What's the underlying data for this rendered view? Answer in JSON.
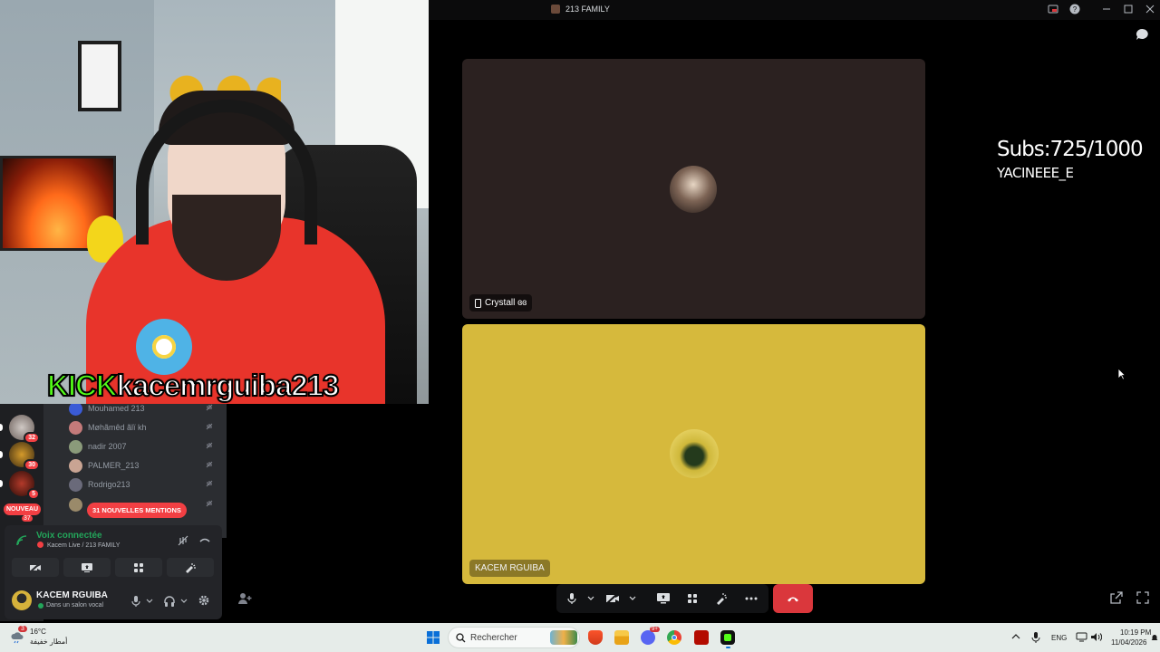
{
  "window": {
    "title": "213 FAMILY"
  },
  "overlay": {
    "kick_label": "KICK",
    "kick_username": "kacemrguiba213",
    "subs": "Subs:725/1000",
    "sub_user": "YACINEEE_E"
  },
  "server_rail": {
    "badges": [
      "32",
      "30",
      "5"
    ],
    "nouveau_label": "NOUVEAU",
    "nouveau_count": "37"
  },
  "members": [
    {
      "name": "Mouhamed 213"
    },
    {
      "name": "Møhãmêd ãlï kh"
    },
    {
      "name": "nadir 2007"
    },
    {
      "name": "PALMER_213"
    },
    {
      "name": "Rodrigo213"
    }
  ],
  "mentions_label": "31 NOUVELLES MENTIONS",
  "voice": {
    "status": "Voix connectée",
    "channel": "Kacem Live / 213 FAMILY"
  },
  "user": {
    "name": "KACEM RGUIBA",
    "status": "Dans un salon vocal"
  },
  "tiles": [
    {
      "name": "Crystall ɞɞ",
      "device": "phone-icon"
    },
    {
      "name": "KACEM RGUIBA"
    }
  ],
  "taskbar": {
    "weather_temp": "16°C",
    "weather_desc": "أمطار خفيفة",
    "weather_badge": "3",
    "search_placeholder": "Rechercher",
    "discord_badge": "9+",
    "lang": "ENG",
    "time": "10:19 PM",
    "date": "11/04/2026"
  },
  "colors": {
    "accent_green": "#23a55a",
    "danger": "#da373c",
    "kick_green": "#53fc18",
    "tile_yellow": "#d6b93c"
  }
}
